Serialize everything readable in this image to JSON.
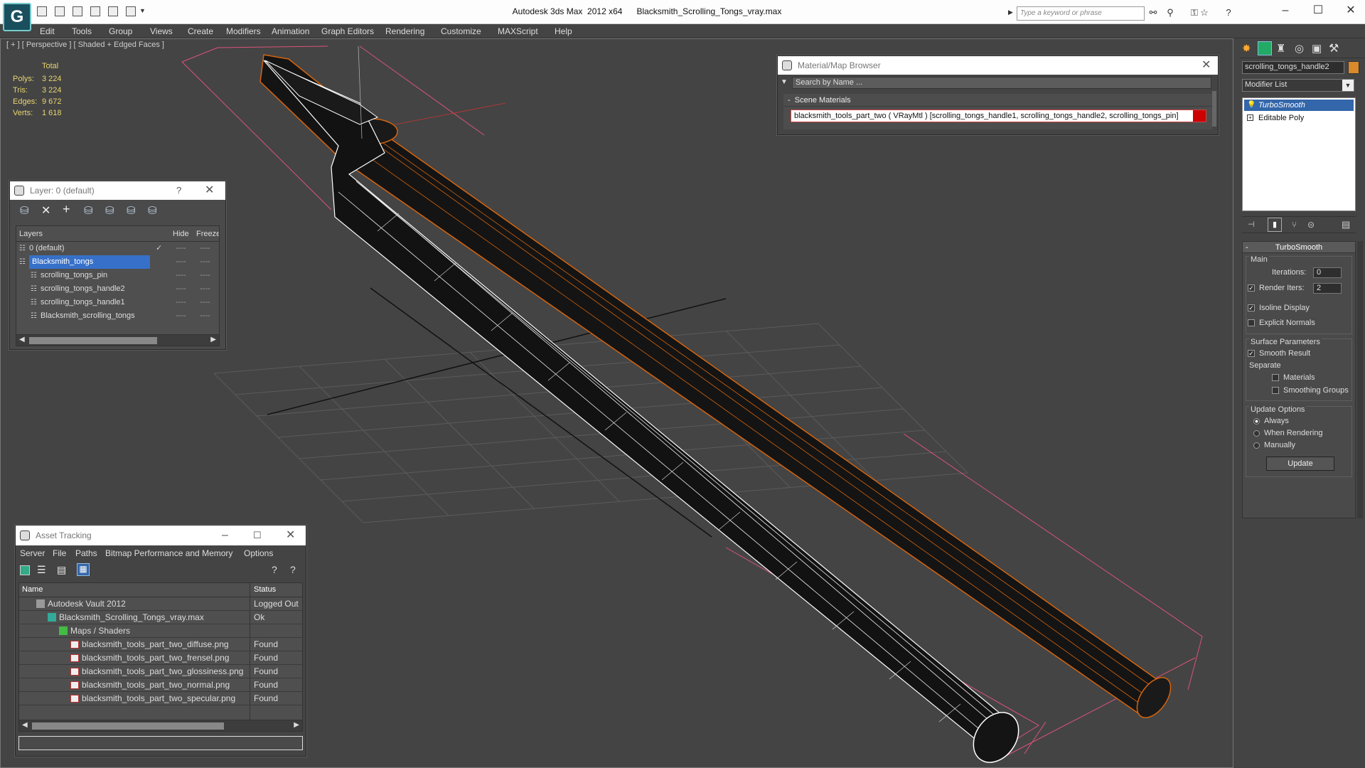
{
  "titlebar": {
    "app_name": "Autodesk 3ds Max  2012 x64",
    "file_name": "Blacksmith_Scrolling_Tongs_vray.max",
    "search_placeholder": "Type a keyword or phrase"
  },
  "menu": [
    "Edit",
    "Tools",
    "Group",
    "Views",
    "Create",
    "Modifiers",
    "Animation",
    "Graph Editors",
    "Rendering",
    "Customize",
    "MAXScript",
    "Help"
  ],
  "viewport": {
    "label": "[ + ] [ Perspective ] [ Shaded + Edged Faces ]",
    "stats": {
      "header": "Total",
      "rows": [
        {
          "label": "Polys:",
          "value": "3 224"
        },
        {
          "label": "Tris:",
          "value": "3 224"
        },
        {
          "label": "Edges:",
          "value": "9 672"
        },
        {
          "label": "Verts:",
          "value": "1 618"
        }
      ]
    }
  },
  "layer_panel": {
    "title": "Layer: 0 (default)",
    "help": "?",
    "col_layers": "Layers",
    "col_hide": "Hide",
    "col_freeze": "Freeze",
    "rows": [
      {
        "name": "0 (default)",
        "indent": 0,
        "selected": false,
        "check": "✓"
      },
      {
        "name": "Blacksmith_tongs",
        "indent": 0,
        "selected": true,
        "check": ""
      },
      {
        "name": "scrolling_tongs_pin",
        "indent": 1,
        "selected": false,
        "check": ""
      },
      {
        "name": "scrolling_tongs_handle2",
        "indent": 1,
        "selected": false,
        "check": ""
      },
      {
        "name": "scrolling_tongs_handle1",
        "indent": 1,
        "selected": false,
        "check": ""
      },
      {
        "name": "Blacksmith_scrolling_tongs",
        "indent": 1,
        "selected": false,
        "check": ""
      }
    ],
    "dash": "----"
  },
  "material_browser": {
    "title": "Material/Map Browser",
    "search_placeholder": "Search by Name ...",
    "section": "Scene Materials",
    "item": "blacksmith_tools_part_two  ( VRayMtl ) [scrolling_tongs_handle1, scrolling_tongs_handle2, scrolling_tongs_pin]"
  },
  "asset_tracking": {
    "title": "Asset Tracking",
    "menu": [
      "Server",
      "File",
      "Paths",
      "Bitmap Performance and Memory",
      "Options"
    ],
    "col_name": "Name",
    "col_status": "Status",
    "rows": [
      {
        "name": "Autodesk Vault 2012",
        "status": "Logged Out",
        "indent": 1,
        "icon": "vault-icon"
      },
      {
        "name": "Blacksmith_Scrolling_Tongs_vray.max",
        "status": "Ok",
        "indent": 2,
        "icon": "max-file-icon"
      },
      {
        "name": "Maps / Shaders",
        "status": "",
        "indent": 3,
        "icon": "folder-icon"
      },
      {
        "name": "blacksmith_tools_part_two_diffuse.png",
        "status": "Found",
        "indent": 4,
        "icon": "png-icon"
      },
      {
        "name": "blacksmith_tools_part_two_frensel.png",
        "status": "Found",
        "indent": 4,
        "icon": "png-icon"
      },
      {
        "name": "blacksmith_tools_part_two_glossiness.png",
        "status": "Found",
        "indent": 4,
        "icon": "png-icon"
      },
      {
        "name": "blacksmith_tools_part_two_normal.png",
        "status": "Found",
        "indent": 4,
        "icon": "png-icon"
      },
      {
        "name": "blacksmith_tools_part_two_specular.png",
        "status": "Found",
        "indent": 4,
        "icon": "png-icon"
      }
    ]
  },
  "command_panel": {
    "object_name": "scrolling_tongs_handle2",
    "object_color": "#d98a2a",
    "modifier_list": "Modifier List",
    "stack": [
      "TurboSmooth",
      "Editable Poly"
    ],
    "rollout_title": "TurboSmooth",
    "main_group": "Main",
    "iterations_label": "Iterations:",
    "iterations_value": "0",
    "render_iters_label": "Render Iters:",
    "render_iters_value": "2",
    "isoline_display": "Isoline Display",
    "explicit_normals": "Explicit Normals",
    "surface_params": "Surface Parameters",
    "smooth_result": "Smooth Result",
    "separate": "Separate",
    "materials": "Materials",
    "smoothing_groups": "Smoothing Groups",
    "update_options": "Update Options",
    "always": "Always",
    "when_rendering": "When Rendering",
    "manually": "Manually",
    "update_button": "Update"
  }
}
